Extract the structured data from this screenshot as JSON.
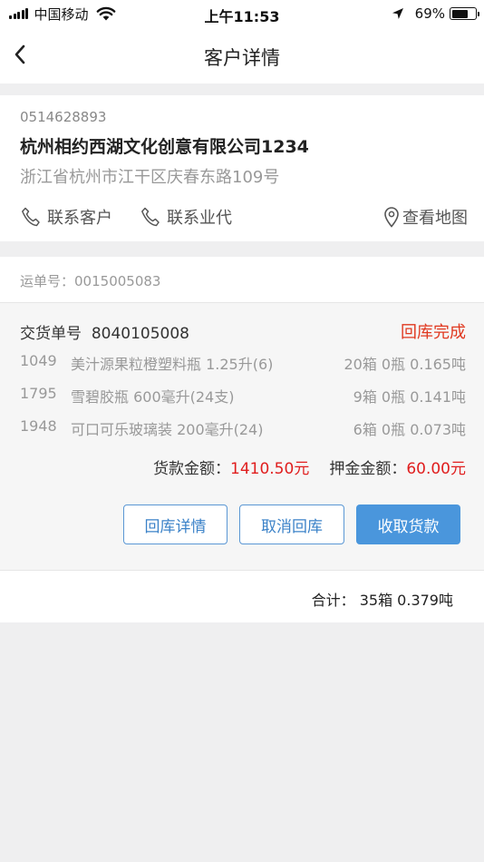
{
  "status_bar": {
    "carrier": "中国移动",
    "time": "上午11:53",
    "battery_percent": "69%",
    "battery_level": 0.69
  },
  "nav": {
    "title": "客户详情"
  },
  "customer": {
    "phone": "0514628893",
    "name": "杭州相约西湖文化创意有限公司1234",
    "address": "浙江省杭州市江干区庆春东路109号",
    "actions": {
      "contact_customer": "联系客户",
      "contact_agent": "联系业代",
      "view_map": "查看地图"
    }
  },
  "order": {
    "waybill_label": "运单号：",
    "waybill_number": "0015005083",
    "delivery_label": "交货单号",
    "delivery_number": "8040105008",
    "status": "回库完成",
    "items": [
      {
        "code": "1049",
        "name": "美汁源果粒橙塑料瓶 1.25升(6)",
        "qty": "20箱  0瓶  0.165吨"
      },
      {
        "code": "1795",
        "name": "雪碧胶瓶 600毫升(24支)",
        "qty": "9箱  0瓶  0.141吨"
      },
      {
        "code": "1948",
        "name": "可口可乐玻璃装 200毫升(24)",
        "qty": "6箱  0瓶  0.073吨"
      }
    ],
    "payment_label": "货款金额：",
    "payment_value": "1410.50元",
    "deposit_label": "押金金额：",
    "deposit_value": "60.00元",
    "buttons": {
      "return_detail": "回库详情",
      "cancel_return": "取消回库",
      "collect_payment": "收取货款"
    }
  },
  "total": {
    "label": "合计：",
    "value": "35箱 0.379吨"
  },
  "colors": {
    "status_red": "#e0381f",
    "amount_red": "#e01e1e",
    "primary_blue": "#4a96dc",
    "background": "#efeff0"
  }
}
